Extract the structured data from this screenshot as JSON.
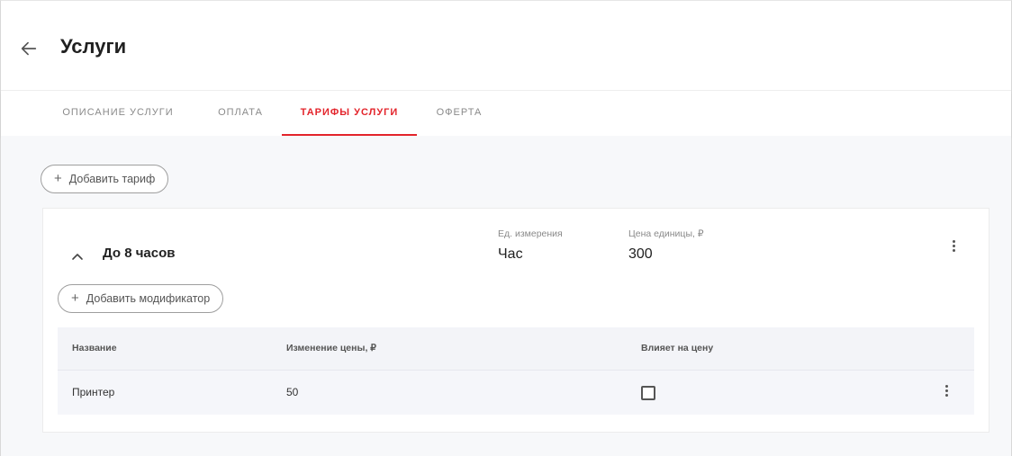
{
  "header": {
    "back_icon": "arrow-left-icon",
    "title": "Услуги"
  },
  "tabs": [
    {
      "label": "Описание услуги",
      "active": false
    },
    {
      "label": "Оплата",
      "active": false
    },
    {
      "label": "Тарифы услуги",
      "active": true
    },
    {
      "label": "Оферта",
      "active": false
    }
  ],
  "actions": {
    "add_tariff": "Добавить тариф",
    "add_modifier": "Добавить модификатор",
    "plus_icon": "plus-icon"
  },
  "tariff": {
    "name": "До 8 часов",
    "unit_label": "Ед. измерения",
    "unit_value": "Час",
    "price_label": "Цена единицы, ₽",
    "price_value": "300"
  },
  "modifiers_table": {
    "columns": [
      "Название",
      "Изменение цены, ₽",
      "Влияет на цену"
    ],
    "rows": [
      {
        "name": "Принтер",
        "price_change": "50",
        "affects_price": false
      }
    ]
  },
  "colors": {
    "accent": "#e3242b",
    "background": "#f7f8fa",
    "text": "#212121",
    "muted": "#8a8a8a"
  }
}
